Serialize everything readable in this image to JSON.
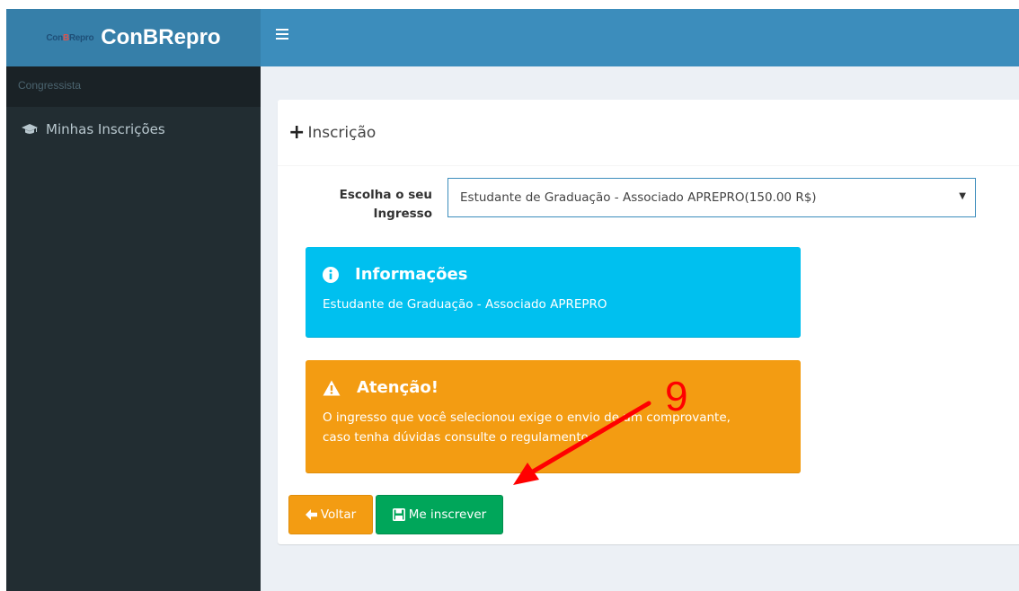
{
  "app": {
    "logo_small_pre": "Con",
    "logo_small_mid": "B",
    "logo_small_post": "Repro",
    "title": "ConBRepro"
  },
  "sidebar": {
    "header": "Congressista",
    "items": [
      {
        "label": "Minhas Inscrições",
        "icon": "graduation-cap-icon"
      }
    ]
  },
  "card": {
    "title": "Inscrição",
    "form": {
      "label_line1": "Escolha o seu",
      "label_line2": "Ingresso",
      "selected": "Estudante de Graduação - Associado APREPRO(150.00 R$)"
    },
    "info": {
      "title": "Informações",
      "text": "Estudante de Graduação - Associado APREPRO"
    },
    "warning": {
      "title": "Atenção!",
      "line1": "O ingresso que você selecionou exige o envio de um comprovante,",
      "line2": "caso tenha dúvidas consulte o regulamento."
    },
    "buttons": {
      "back": "Voltar",
      "submit": "Me inscrever"
    }
  },
  "annotation": {
    "number": "9",
    "color": "#ff0000"
  },
  "colors": {
    "topbar": "#3c8dbc",
    "logo": "#367fa9",
    "sidebar": "#222d32",
    "info": "#00c0ef",
    "warning": "#f39c12",
    "success": "#00a65a"
  }
}
